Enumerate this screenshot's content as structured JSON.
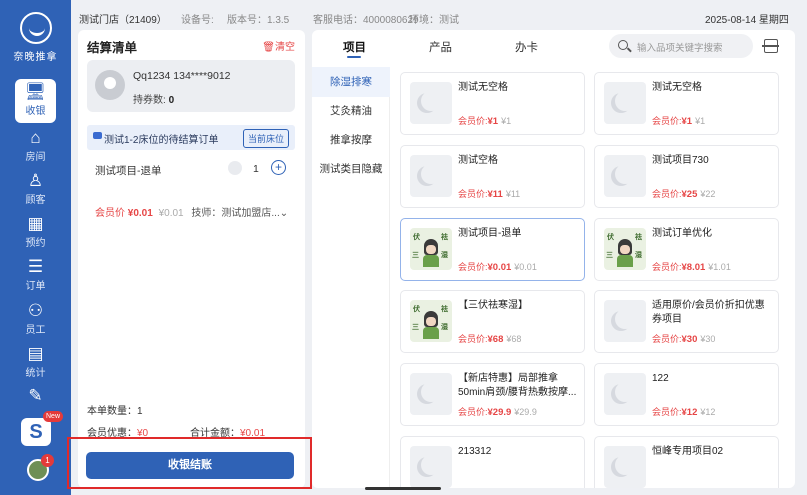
{
  "brand": {
    "name": "奈晚推拿"
  },
  "nav": {
    "items": [
      {
        "label": "收银",
        "icon": "monitor-icon",
        "active": true
      },
      {
        "label": "房间",
        "icon": "home-icon",
        "active": false
      },
      {
        "label": "顾客",
        "icon": "user-icon",
        "active": false
      },
      {
        "label": "预约",
        "icon": "calendar-icon",
        "active": false
      },
      {
        "label": "订单",
        "icon": "order-icon",
        "active": false
      },
      {
        "label": "员工",
        "icon": "staff-icon",
        "active": false
      },
      {
        "label": "统计",
        "icon": "chart-icon",
        "active": false
      },
      {
        "label": "",
        "icon": "pen-icon",
        "active": false
      }
    ],
    "s_badge": "New",
    "avatar_badge": "1"
  },
  "topbar": {
    "store": "测试门店（21409）",
    "device": "设备号:",
    "version": "版本号：1.3.5",
    "phone": "客服电话：4000080629",
    "env": "环境：测试",
    "date": "2025-08-14 星期四"
  },
  "cart": {
    "title": "结算清单",
    "clear": "清空",
    "member": {
      "name": "Qq1234 134****9012",
      "coupon_label": "持券数:",
      "coupon_count": "0"
    },
    "order_title": "测试1-2床位的待结算订单",
    "current_bed": "当前床位",
    "item": {
      "name": "测试项目-退单",
      "qty": "1",
      "member_price_label": "会员价",
      "member_price": "¥0.01",
      "orig_price": "¥0.01",
      "technician": "技师：测试加盟店..."
    },
    "summary": {
      "count_label": "本单数量：",
      "count": "1",
      "discount_label": "会员优惠：",
      "discount": "¥0",
      "total_label": "合计金额：",
      "total": "¥0.01"
    },
    "checkout": "收银结账"
  },
  "main": {
    "tabs": [
      "项目",
      "产品",
      "办卡"
    ],
    "active_tab": 0,
    "search": {
      "placeholder": "输入品项关键字搜索"
    },
    "categories": [
      "除湿排寒",
      "艾灸精油",
      "推拿按摩",
      "测试类目隐藏"
    ],
    "active_category": 0,
    "price_label": "会员价:",
    "products": [
      {
        "name": "测试无空格",
        "price": "¥1",
        "orig": "¥1",
        "image": "moon-logo",
        "selected": false
      },
      {
        "name": "测试无空格",
        "price": "¥1",
        "orig": "¥1",
        "image": "moon-logo",
        "selected": false
      },
      {
        "name": "测试空格",
        "price": "¥11",
        "orig": "¥11",
        "image": "moon-logo",
        "selected": false
      },
      {
        "name": "测试项目730",
        "price": "¥25",
        "orig": "¥22",
        "image": "moon-logo",
        "selected": false
      },
      {
        "name": "测试项目-退单",
        "price": "¥0.01",
        "orig": "¥0.01",
        "image": "illustration",
        "selected": true
      },
      {
        "name": "测试订单优化",
        "price": "¥8.01",
        "orig": "¥1.01",
        "image": "illustration",
        "selected": false
      },
      {
        "name": "【三伏祛寒湿】",
        "price": "¥68",
        "orig": "¥68",
        "image": "illustration",
        "selected": false
      },
      {
        "name": "适用原价/会员价折扣优惠券项目",
        "price": "¥30",
        "orig": "¥30",
        "image": "moon-logo",
        "selected": false
      },
      {
        "name": "【新店特惠】局部推拿50min肩颈/腰背热敷按摩...",
        "price": "¥29.9",
        "orig": "¥29.9",
        "image": "moon-logo",
        "selected": false
      },
      {
        "name": "122",
        "price": "¥12",
        "orig": "¥12",
        "image": "moon-logo",
        "selected": false
      },
      {
        "name": "213312",
        "price": "",
        "orig": "",
        "image": "moon-logo",
        "selected": false
      },
      {
        "name": "恒峰专用项目02",
        "price": "",
        "orig": "",
        "image": "moon-logo",
        "selected": false
      }
    ]
  }
}
